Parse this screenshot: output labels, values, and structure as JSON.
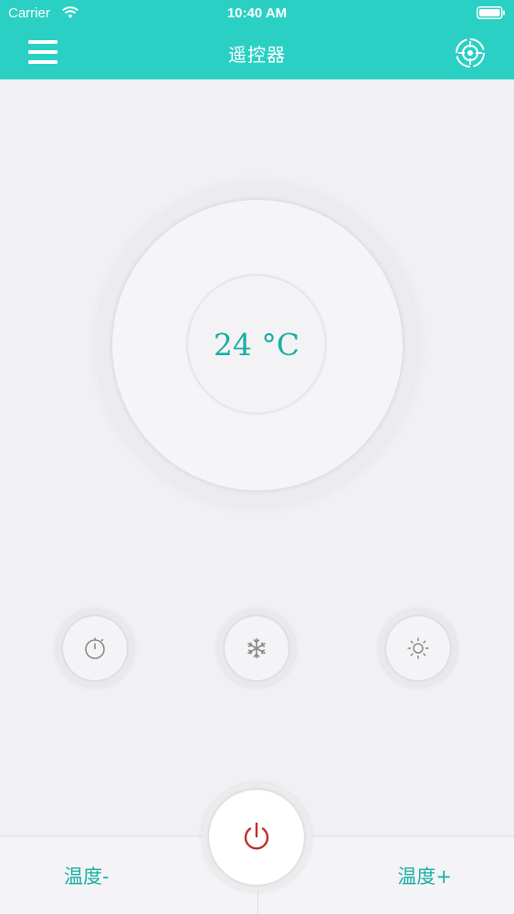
{
  "status_bar": {
    "carrier": "Carrier",
    "time": "10:40 AM"
  },
  "header": {
    "title": "遥控器",
    "menu_icon": "hamburger-menu-icon",
    "right_icon": "crosshair-target-icon"
  },
  "dial": {
    "temperature": "24 °C"
  },
  "modes": [
    {
      "name": "timer",
      "icon": "stopwatch-icon"
    },
    {
      "name": "cool",
      "icon": "snowflake-icon"
    },
    {
      "name": "heat",
      "icon": "sun-icon"
    }
  ],
  "controls": {
    "temp_down_label": "温度-",
    "temp_up_label": "温度+",
    "power_icon": "power-icon"
  },
  "colors": {
    "accent": "#2bd0c4",
    "text_accent": "#1aaea3",
    "power": "#b8322a",
    "background": "#f1f1f3"
  }
}
